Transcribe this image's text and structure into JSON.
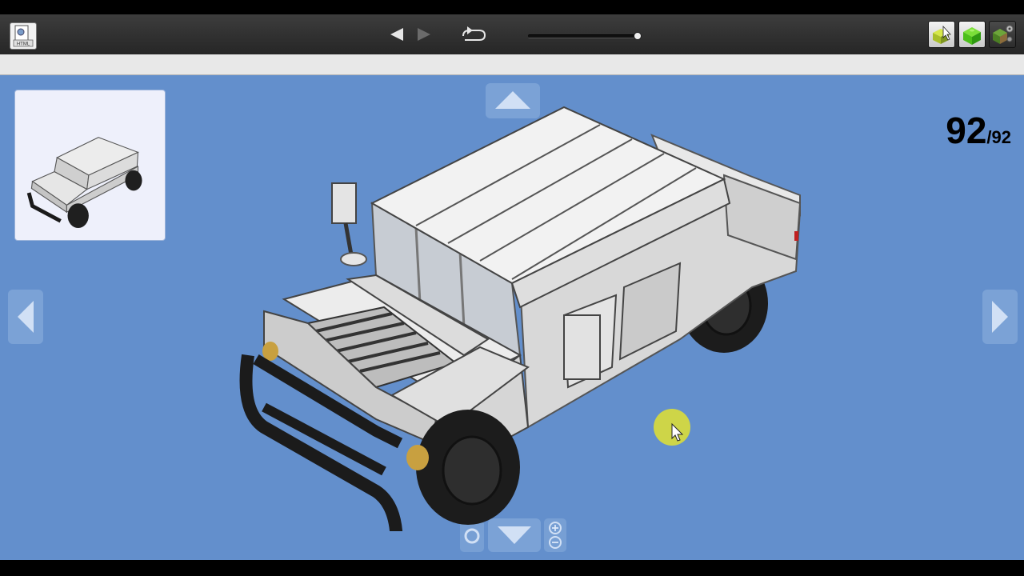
{
  "toolbar": {
    "html_button_label": "HTML",
    "icons": {
      "html": "html-export-icon",
      "prev": "previous-step-icon",
      "next": "next-step-icon",
      "rotate": "rotate-view-icon",
      "mode1": "build-mode-cursor-icon",
      "mode2": "part-list-icon",
      "mode3": "settings-icon"
    },
    "slider_position": 1.0
  },
  "viewer": {
    "background_color": "#638fcc",
    "step_current": "92",
    "step_total": "/92",
    "model_name": "humvee-model"
  }
}
